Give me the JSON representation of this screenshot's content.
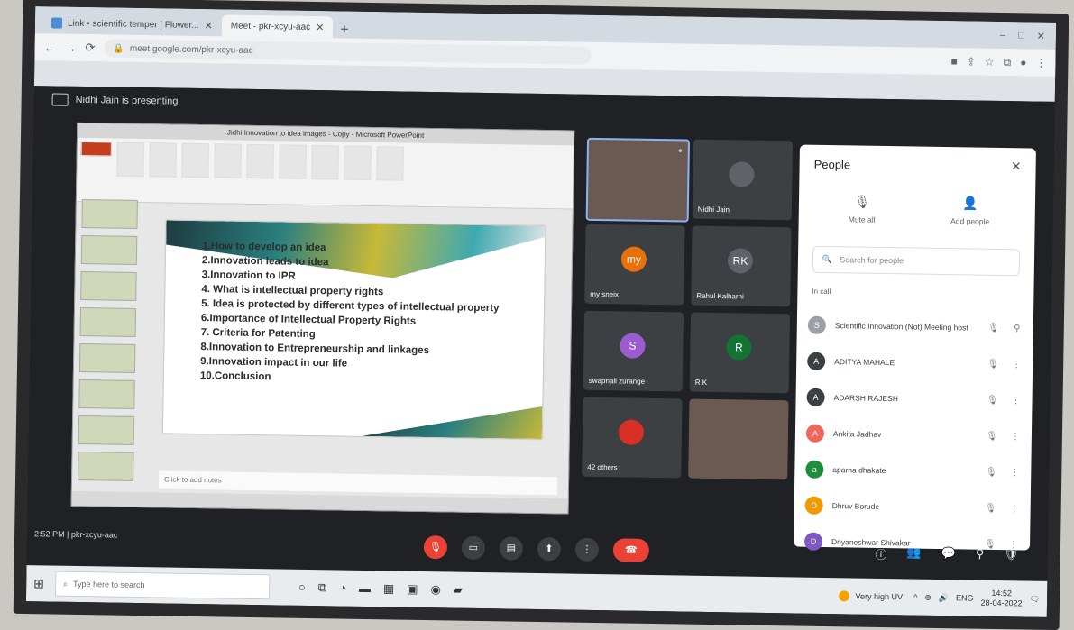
{
  "browser": {
    "tabs": [
      {
        "label": "Link • scientific temper | Flower..."
      },
      {
        "label": "Meet - pkr-xcyu-aac"
      }
    ],
    "new_tab": "+",
    "address": "meet.google.com/pkr-xcyu-aac",
    "window_controls": [
      "–",
      "□",
      "✕"
    ]
  },
  "meet": {
    "presenting": "Nidhi Jain is presenting",
    "clock": "2:52 PM  |  pkr-xcyu-aac"
  },
  "ppt": {
    "window_title": "Jidhi Innovation to idea images - Copy - Microsoft PowerPoint",
    "notes_placeholder": "Click to add notes",
    "slide_items": [
      "1.How to develop an idea",
      "2.Innovation leads to idea",
      "3.Innovation to IPR",
      "4. What is intellectual property rights",
      "5. Idea is protected by different types of intellectual property",
      "6.Importance of Intellectual Property Rights",
      "7. Criteria for Patenting",
      "8.Innovation to Entrepreneurship and linkages",
      "9.Innovation impact in our life",
      "10.Conclusion"
    ]
  },
  "tiles": [
    {
      "name": "Nidhi Jain",
      "avatar": "",
      "color": "#5f6368",
      "video": false
    },
    {
      "name": "my sneix",
      "avatar": "my",
      "color": "#e8710a",
      "video": false
    },
    {
      "name": "Rahul Kalharni",
      "avatar": "RK",
      "color": "#5f6368",
      "video": false
    },
    {
      "name": "swapnali zurange",
      "avatar": "S",
      "color": "#9c5ccf",
      "video": false
    },
    {
      "name": "R K",
      "avatar": "R",
      "color": "#137333",
      "video": false
    },
    {
      "name": "42 others",
      "avatar": "",
      "color": "#d93025",
      "video": false
    }
  ],
  "people": {
    "title": "People",
    "mute_all": "Mute all",
    "add_people": "Add people",
    "search_placeholder": "Search for people",
    "in_call": "In call",
    "list": [
      {
        "name": "Scientific Innovation (Not) Meeting host",
        "avatar": "S",
        "color": "#9aa0a6"
      },
      {
        "name": "ADITYA MAHALE",
        "avatar": "A",
        "color": "#3c4043"
      },
      {
        "name": "ADARSH RAJESH",
        "avatar": "A",
        "color": "#3c4043"
      },
      {
        "name": "Ankita Jadhav",
        "avatar": "A",
        "color": "#ee675c"
      },
      {
        "name": "aparna dhakate",
        "avatar": "a",
        "color": "#1e8e3e"
      },
      {
        "name": "Dhruv Borude",
        "avatar": "D",
        "color": "#f29900"
      },
      {
        "name": "Dnyaneshwar Shivakar",
        "avatar": "D",
        "color": "#7e57c2"
      }
    ]
  },
  "taskbar": {
    "search": "Type here to search",
    "weather": "Very high UV",
    "lang": "ENG",
    "time": "14:52",
    "date": "28-04-2022"
  }
}
